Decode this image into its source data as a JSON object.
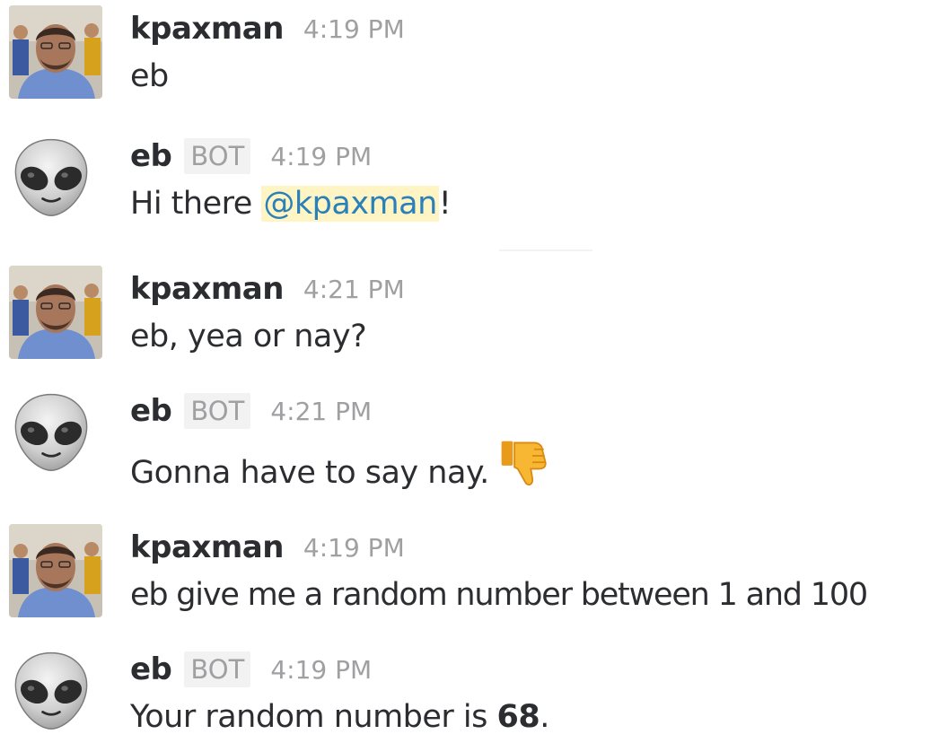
{
  "messages": [
    {
      "author": "kpaxman",
      "is_bot": false,
      "time": "4:19 PM",
      "text": "eb"
    },
    {
      "author": "eb",
      "is_bot": true,
      "badge": "BOT",
      "time": "4:19 PM",
      "text_prefix": "Hi there ",
      "mention": "@kpaxman",
      "text_suffix": "!"
    },
    {
      "author": "kpaxman",
      "is_bot": false,
      "time": "4:21 PM",
      "text": "eb, yea or nay?"
    },
    {
      "author": "eb",
      "is_bot": true,
      "badge": "BOT",
      "time": "4:21 PM",
      "text": "Gonna have to say nay.",
      "emoji": "thumbsdown-icon"
    },
    {
      "author": "kpaxman",
      "is_bot": false,
      "time": "4:19 PM",
      "text": "eb give me a random number between 1 and 100"
    },
    {
      "author": "eb",
      "is_bot": true,
      "badge": "BOT",
      "time": "4:19 PM",
      "text_prefix": "Your random number is ",
      "number": "68",
      "text_suffix": "."
    }
  ],
  "colors": {
    "mention_bg": "#fef4c4",
    "mention_text": "#2a80b9",
    "timestamp": "#a0a0a2"
  }
}
